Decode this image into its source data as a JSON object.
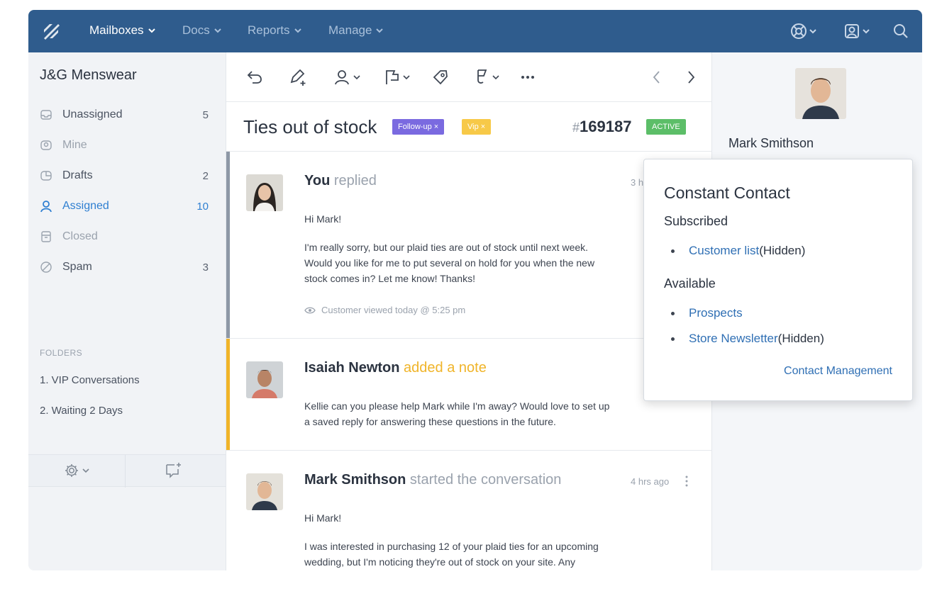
{
  "topbar": {
    "nav": [
      {
        "label": "Mailboxes"
      },
      {
        "label": "Docs"
      },
      {
        "label": "Reports"
      },
      {
        "label": "Manage"
      }
    ],
    "icons": [
      "help-icon",
      "account-icon",
      "search-icon"
    ]
  },
  "sidebar": {
    "mailbox_title": "J&G Menswear",
    "items": [
      {
        "label": "Unassigned",
        "count": "5",
        "icon": "inbox-icon"
      },
      {
        "label": "Mine",
        "count": "",
        "icon": "mine-icon"
      },
      {
        "label": "Drafts",
        "count": "2",
        "icon": "drafts-icon"
      },
      {
        "label": "Assigned",
        "count": "10",
        "icon": "person-icon"
      },
      {
        "label": "Closed",
        "count": "",
        "icon": "archive-icon"
      },
      {
        "label": "Spam",
        "count": "3",
        "icon": "spam-icon"
      }
    ],
    "folders_heading": "FOLDERS",
    "folders": [
      {
        "label": "1. VIP Conversations"
      },
      {
        "label": "2. Waiting 2 Days"
      }
    ]
  },
  "toolbar": {
    "icons": [
      "reply-icon",
      "note-icon",
      "assign-icon",
      "status-flag-icon",
      "tag-icon",
      "workflow-icon",
      "more-icon",
      "prev-icon",
      "next-icon"
    ]
  },
  "conversation": {
    "subject": "Ties out of stock",
    "tags": [
      {
        "label": "Follow-up ×",
        "color": "#7a6ae0"
      },
      {
        "label": "Vip ×",
        "color": "#f7c948"
      }
    ],
    "ticket_hash": "#",
    "ticket_number": "169187",
    "status": "ACTIVE",
    "threads": [
      {
        "author": "You",
        "verb": "replied",
        "time": "3 h",
        "greeting": "Hi Mark!",
        "body": [
          "I'm really sorry, but our plaid ties are out of stock until next week.",
          "Would you like for me to put several on hold for you when the new",
          "stock comes in? Let me know! Thanks!"
        ],
        "meta": "Customer viewed today @ 5:25 pm"
      },
      {
        "author": "Isaiah Newton",
        "verb": "added a note",
        "body": [
          "Kellie can you please help Mark while I'm away? Would love to set up",
          "a saved reply for answering these questions in the future."
        ]
      },
      {
        "author": "Mark Smithson",
        "verb": "started the conversation",
        "time": "4 hrs ago",
        "greeting": "Hi Mark!",
        "body": [
          "I was interested in purchasing 12 of your plaid ties for an upcoming",
          "wedding, but I'm noticing they're out of stock on your site. Any"
        ]
      }
    ]
  },
  "customer": {
    "name": "Mark Smithson"
  },
  "popover": {
    "title": "Constant Contact",
    "subscribed_heading": "Subscribed",
    "subscribed": [
      {
        "link": "Customer list",
        "suffix": " (Hidden)"
      }
    ],
    "available_heading": "Available",
    "available": [
      {
        "link": "Prospects",
        "suffix": ""
      },
      {
        "link": "Store Newsletter",
        "suffix": " (Hidden)"
      }
    ],
    "footer_link": "Contact Management"
  }
}
